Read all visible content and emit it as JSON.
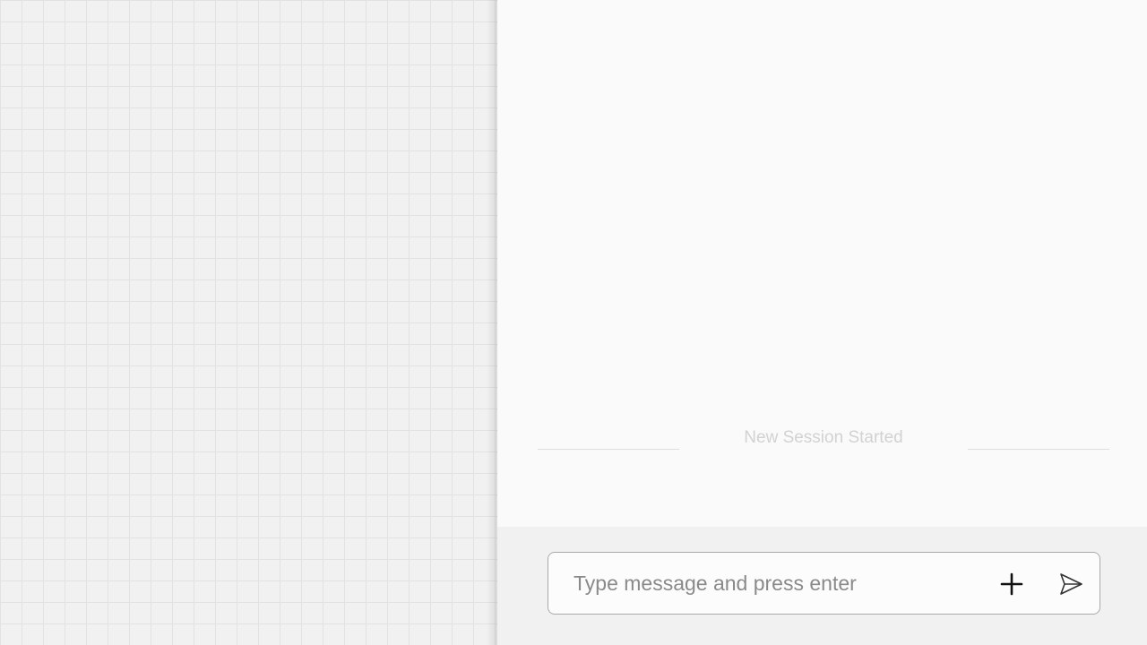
{
  "chat": {
    "session_divider_text": "New Session Started",
    "composer": {
      "placeholder": "Type message and press enter",
      "value": ""
    },
    "icons": {
      "add": "plus-icon",
      "send": "send-icon"
    }
  },
  "colors": {
    "canvas_bg": "#f1f1f1",
    "grid_line": "#e2e2e2",
    "panel_bg": "#fafafa",
    "composer_border": "#a9a9a9",
    "placeholder_text": "#8a8a8a",
    "divider_text": "#d2d2d2"
  }
}
